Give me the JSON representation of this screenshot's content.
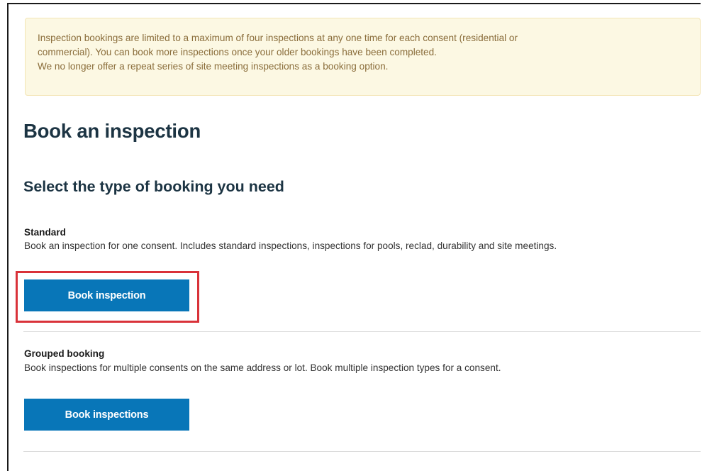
{
  "notice": {
    "line1": "Inspection bookings are limited to a maximum of four inspections at any one time for each consent (residential or",
    "line2": "commercial). You can book more inspections once your older bookings have been completed.",
    "line3": "We no longer offer a repeat series of site meeting inspections as a booking option."
  },
  "page_title": "Book an inspection",
  "sub_title": "Select the type of booking you need",
  "standard": {
    "heading": "Standard",
    "description": "Book an inspection for one consent. Includes standard inspections, inspections for pools, reclad, durability and site meetings.",
    "button_label": "Book inspection"
  },
  "grouped": {
    "heading": "Grouped booking",
    "description": "Book inspections for multiple consents on the same address or lot. Book multiple inspection types for a consent.",
    "button_label": "Book inspections"
  },
  "colors": {
    "button": "#0876b8",
    "highlight": "#d93239",
    "notice_bg": "#fcf8e3",
    "notice_text": "#8a6d3b",
    "heading": "#1c3443"
  }
}
